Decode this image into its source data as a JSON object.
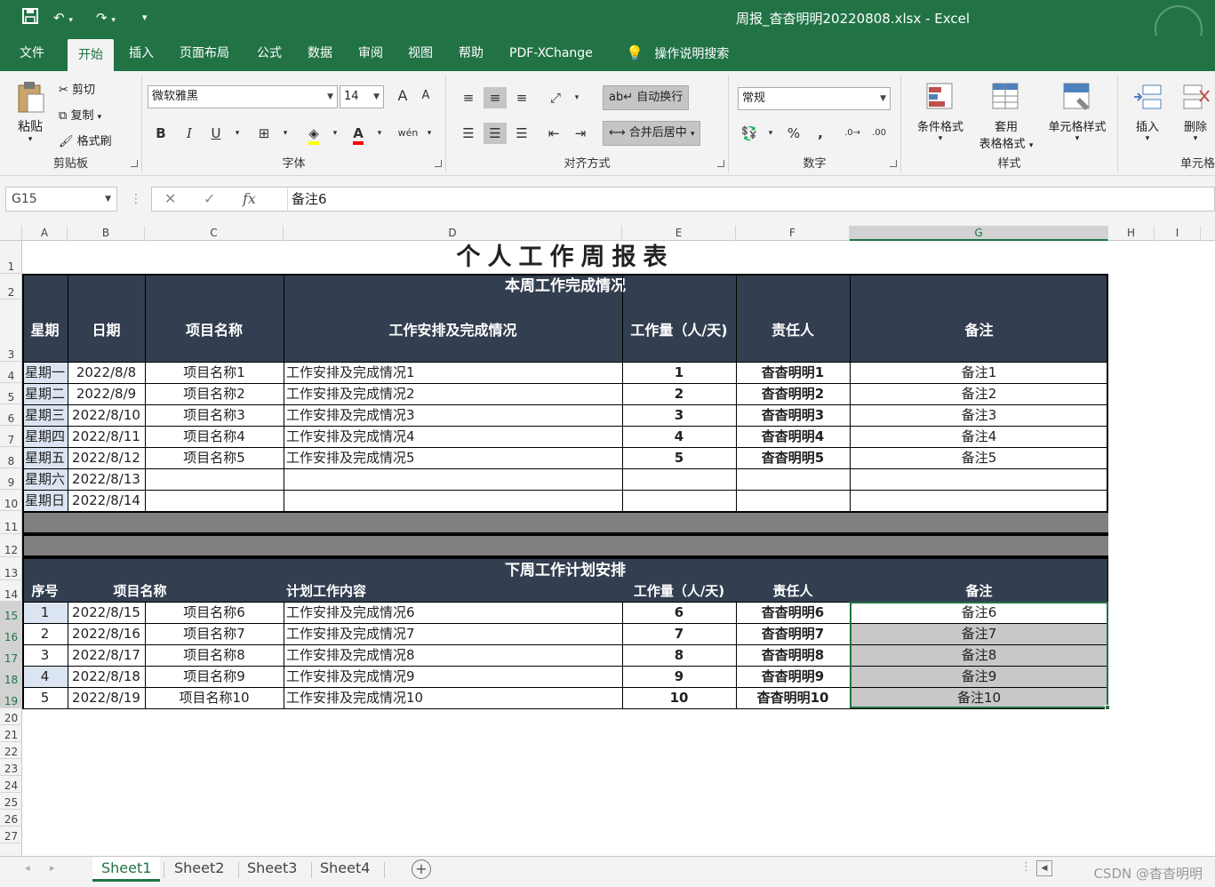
{
  "titlebar": {
    "window_title": "周报_杳杳明明20220808.xlsx  -  Excel",
    "save_icon": "save-icon",
    "undo_icon": "undo-icon",
    "redo_icon": "redo-icon",
    "customize_icon": "customize-icon"
  },
  "menu": {
    "items": [
      "文件",
      "开始",
      "插入",
      "页面布局",
      "公式",
      "数据",
      "审阅",
      "视图",
      "帮助",
      "PDF-XChange"
    ],
    "active": "开始",
    "tell_me": "操作说明搜索"
  },
  "ribbon": {
    "clipboard": {
      "paste": "粘贴",
      "cut": "剪切",
      "copy": "复制",
      "format_painter": "格式刷",
      "label": "剪贴板"
    },
    "font": {
      "name": "微软雅黑",
      "size": "14",
      "grow": "A",
      "shrink": "A",
      "bold": "B",
      "italic": "I",
      "underline": "U",
      "label": "字体"
    },
    "alignment": {
      "wrap": "自动换行",
      "merge": "合并后居中",
      "label": "对齐方式"
    },
    "number": {
      "format": "常规",
      "percent": "%",
      "comma": ",",
      "label": "数字"
    },
    "styles": {
      "conditional": "条件格式",
      "table_a": "套用",
      "table_b": "表格格式",
      "cell_styles": "单元格样式",
      "label": "样式"
    },
    "cells": {
      "insert": "插入",
      "delete": "删除",
      "label": "单元格"
    }
  },
  "formula_bar": {
    "name_box": "G15",
    "fx": "fx",
    "value": "备注6"
  },
  "columns": [
    "A",
    "B",
    "C",
    "D",
    "E",
    "F",
    "G",
    "H",
    "I"
  ],
  "rows": [
    "1",
    "2",
    "3",
    "4",
    "5",
    "6",
    "7",
    "8",
    "9",
    "10",
    "11",
    "12",
    "13",
    "14",
    "15",
    "16",
    "17",
    "18",
    "19",
    "20",
    "21",
    "22",
    "23",
    "24",
    "25",
    "26",
    "27"
  ],
  "sheet": {
    "title": "个人工作周报表",
    "section1": "本周工作完成情况",
    "headers1": [
      "星期",
      "日期",
      "项目名称",
      "工作安排及完成情况",
      "工作量（人/天)",
      "责任人",
      "备注"
    ],
    "rows1": [
      [
        "星期一",
        "2022/8/8",
        "项目名称1",
        "工作安排及完成情况1",
        "1",
        "杳杳明明1",
        "备注1"
      ],
      [
        "星期二",
        "2022/8/9",
        "项目名称2",
        "工作安排及完成情况2",
        "2",
        "杳杳明明2",
        "备注2"
      ],
      [
        "星期三",
        "2022/8/10",
        "项目名称3",
        "工作安排及完成情况3",
        "3",
        "杳杳明明3",
        "备注3"
      ],
      [
        "星期四",
        "2022/8/11",
        "项目名称4",
        "工作安排及完成情况4",
        "4",
        "杳杳明明4",
        "备注4"
      ],
      [
        "星期五",
        "2022/8/12",
        "项目名称5",
        "工作安排及完成情况5",
        "5",
        "杳杳明明5",
        "备注5"
      ],
      [
        "星期六",
        "2022/8/13",
        "",
        "",
        "",
        "",
        ""
      ],
      [
        "星期日",
        "2022/8/14",
        "",
        "",
        "",
        "",
        ""
      ]
    ],
    "section2": "下周工作计划安排",
    "headers2": [
      "序号",
      "项目名称",
      "计划工作内容",
      "工作量（人/天)",
      "责任人",
      "备注"
    ],
    "rows2": [
      [
        "1",
        "2022/8/15",
        "项目名称6",
        "工作安排及完成情况6",
        "6",
        "杳杳明明6",
        "备注6"
      ],
      [
        "2",
        "2022/8/16",
        "项目名称7",
        "工作安排及完成情况7",
        "7",
        "杳杳明明7",
        "备注7"
      ],
      [
        "3",
        "2022/8/17",
        "项目名称8",
        "工作安排及完成情况8",
        "8",
        "杳杳明明8",
        "备注8"
      ],
      [
        "4",
        "2022/8/18",
        "项目名称9",
        "工作安排及完成情况9",
        "9",
        "杳杳明明9",
        "备注9"
      ],
      [
        "5",
        "2022/8/19",
        "项目名称10",
        "工作安排及完成情况10",
        "10",
        "杳杳明明10",
        "备注10"
      ]
    ]
  },
  "tabs": [
    "Sheet1",
    "Sheet2",
    "Sheet3",
    "Sheet4"
  ],
  "active_tab": "Sheet1",
  "watermark": "CSDN @杳杳明明",
  "colors": {
    "accent": "#217346",
    "header_band": "#333f50",
    "grey_band": "#808080",
    "selection": "#c8c8c8"
  }
}
